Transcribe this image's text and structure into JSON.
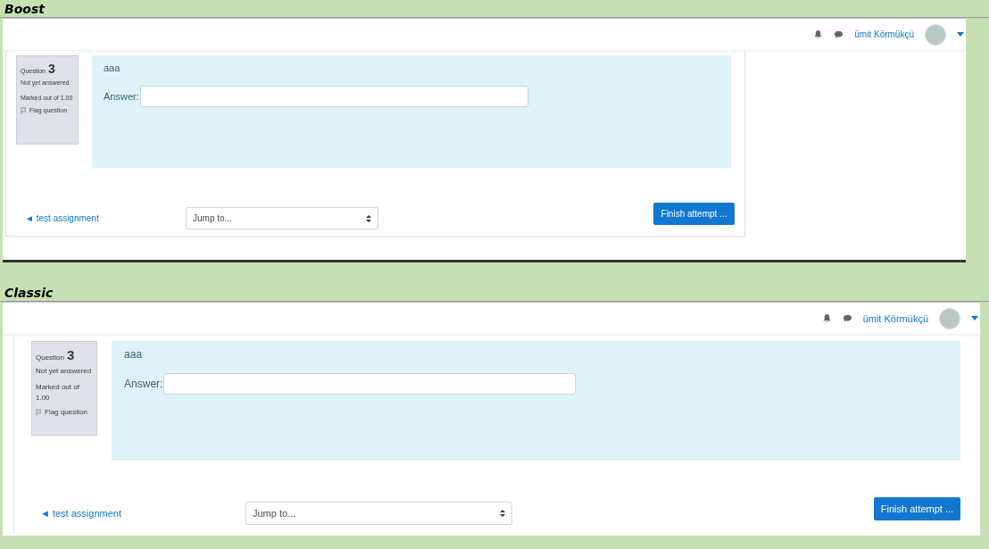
{
  "screens": [
    {
      "kind": "boost",
      "label": "Boost",
      "user": {
        "name": "ümit Körmükçü"
      },
      "question": {
        "heading": "Question",
        "number": "3",
        "status": "Not yet answered",
        "marks": "Marked out of 1.00",
        "flag": "Flag question",
        "text": "aaa",
        "answer_label": "Answer:"
      },
      "nav": {
        "back_link": "◄ test assignment",
        "jump": "Jump to...",
        "finish": "Finish attempt ..."
      }
    },
    {
      "kind": "classic",
      "label": "Classic",
      "user": {
        "name": "ümit Körmükçü"
      },
      "question": {
        "heading": "Question",
        "number": "3",
        "status": "Not yet answered",
        "marks": "Marked out of 1.00",
        "flag": "Flag question",
        "text": "aaa",
        "answer_label": "Answer:"
      },
      "nav": {
        "back_link": "◄ test assignment",
        "jump": "Jump to...",
        "finish": "Finish attempt ..."
      }
    }
  ]
}
